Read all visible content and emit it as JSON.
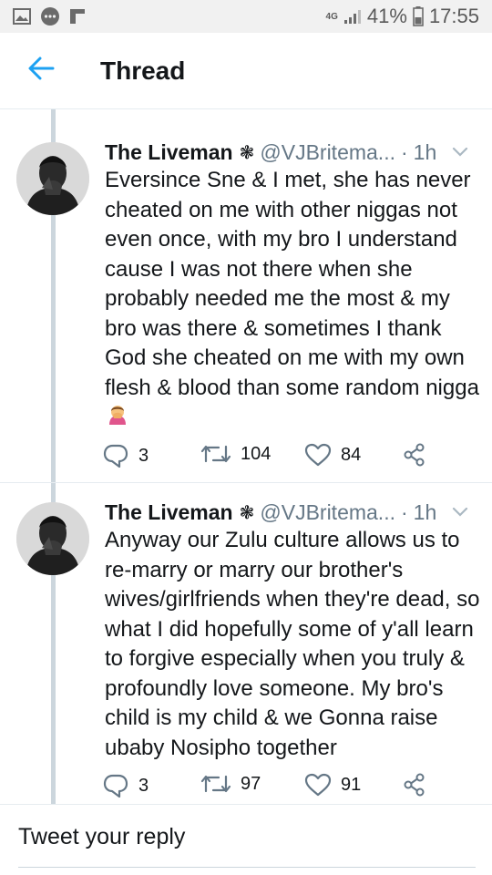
{
  "status_bar": {
    "network": "4G",
    "battery": "41%",
    "time": "17:55",
    "icons": [
      "gallery-icon",
      "chat-bubble-icon",
      "flipboard-icon",
      "signal-icon",
      "battery-icon"
    ]
  },
  "header": {
    "back_icon": "arrow-left-icon",
    "title": "Thread",
    "accent": "#1da1f2"
  },
  "tweets": [
    {
      "name": "The Liveman",
      "badge": "❃",
      "handle": "@VJBritema...",
      "separator": "·",
      "time": "1h",
      "text": "Eversince Sne & I met, she has never cheated on me with other niggas not even once, with my bro I understand cause I was not there when she probably needed me the most & my bro was there & sometimes I thank God she cheated on me with my own flesh & blood than some random nigga",
      "emoji": "facepalm-emoji",
      "replies": "3",
      "retweets": "104",
      "likes": "84"
    },
    {
      "name": "The Liveman",
      "badge": "❃",
      "handle": "@VJBritema...",
      "separator": "·",
      "time": "1h",
      "text": "Anyway our Zulu culture allows us to re-marry or marry our brother's wives/girlfriends when they're dead, so what I did hopefully some of y'all learn to forgive especially when you truly & profoundly love someone. My bro's child is my child & we Gonna raise ubaby Nosipho together",
      "replies": "3",
      "retweets": "97",
      "likes": "91"
    }
  ],
  "reply_box": {
    "placeholder": "Tweet your reply"
  },
  "colors": {
    "text": "#14171a",
    "secondary": "#657786",
    "divider": "#e6ecf0",
    "thread_line": "#ccd6dd",
    "status_bar_bg": "#f1f1f1"
  }
}
